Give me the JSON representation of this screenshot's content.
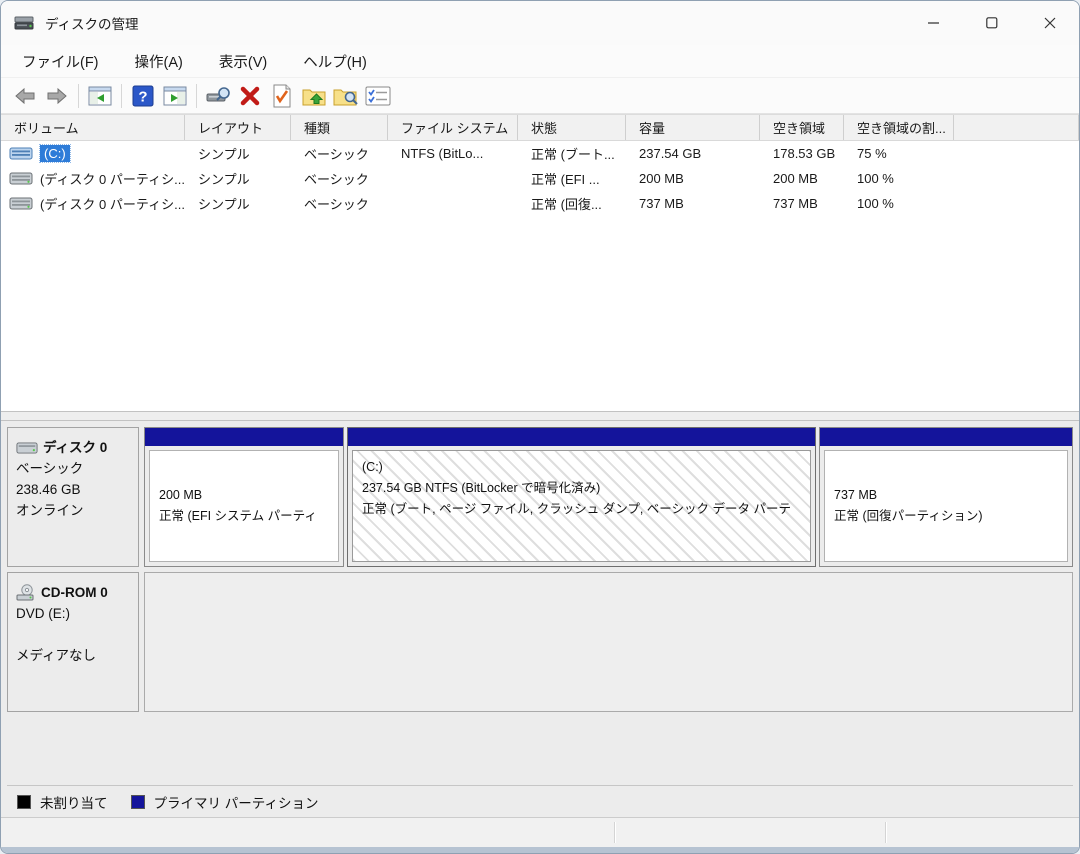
{
  "window": {
    "title": "ディスクの管理"
  },
  "menu": {
    "items": [
      {
        "label": "ファイル(F)"
      },
      {
        "label": "操作(A)"
      },
      {
        "label": "表示(V)"
      },
      {
        "label": "ヘルプ(H)"
      }
    ]
  },
  "toolbar": {
    "icons": [
      "back-icon",
      "forward-icon",
      "show-console-tree-icon",
      "help-icon",
      "show-action-pane-icon",
      "rescan-disks-icon",
      "delete-icon",
      "properties-icon",
      "folder-up-icon",
      "explore-icon",
      "options-icon"
    ]
  },
  "volume_table": {
    "columns": [
      "ボリューム",
      "レイアウト",
      "種類",
      "ファイル システム",
      "状態",
      "容量",
      "空き領域",
      "空き領域の割..."
    ],
    "rows": [
      {
        "volume": "(C:)",
        "layout": "シンプル",
        "type": "ベーシック",
        "filesystem": "NTFS (BitLo...",
        "status": "正常 (ブート...",
        "capacity": "237.54 GB",
        "free": "178.53 GB",
        "percent": "75 %"
      },
      {
        "volume": "(ディスク 0 パーティシ...",
        "layout": "シンプル",
        "type": "ベーシック",
        "filesystem": "",
        "status": "正常 (EFI ...",
        "capacity": "200 MB",
        "free": "200 MB",
        "percent": "100 %"
      },
      {
        "volume": "(ディスク 0 パーティシ...",
        "layout": "シンプル",
        "type": "ベーシック",
        "filesystem": "",
        "status": "正常 (回復...",
        "capacity": "737 MB",
        "free": "737 MB",
        "percent": "100 %"
      }
    ]
  },
  "disk0": {
    "name": "ディスク 0",
    "type": "ベーシック",
    "size": "238.46 GB",
    "status": "オンライン",
    "partitions": [
      {
        "line1": "200 MB",
        "line2": "正常 (EFI システム パーティ"
      },
      {
        "label": "(C:)",
        "line1": "237.54 GB NTFS (BitLocker で暗号化済み)",
        "line2": "正常 (ブート, ページ ファイル, クラッシュ ダンプ, ベーシック データ パーテ"
      },
      {
        "line1": "737 MB",
        "line2": "正常 (回復パーティション)"
      }
    ]
  },
  "cdrom": {
    "name": "CD-ROM 0",
    "drive": "DVD (E:)",
    "media": "メディアなし"
  },
  "legend": {
    "items": [
      {
        "label": "未割り当て",
        "color": "#000000"
      },
      {
        "label": "プライマリ パーティション",
        "color": "#14149b"
      }
    ]
  },
  "colors": {
    "selection_blue": "#2e7cd8",
    "partition_bar_navy": "#14149b",
    "unallocated_black": "#000000"
  }
}
